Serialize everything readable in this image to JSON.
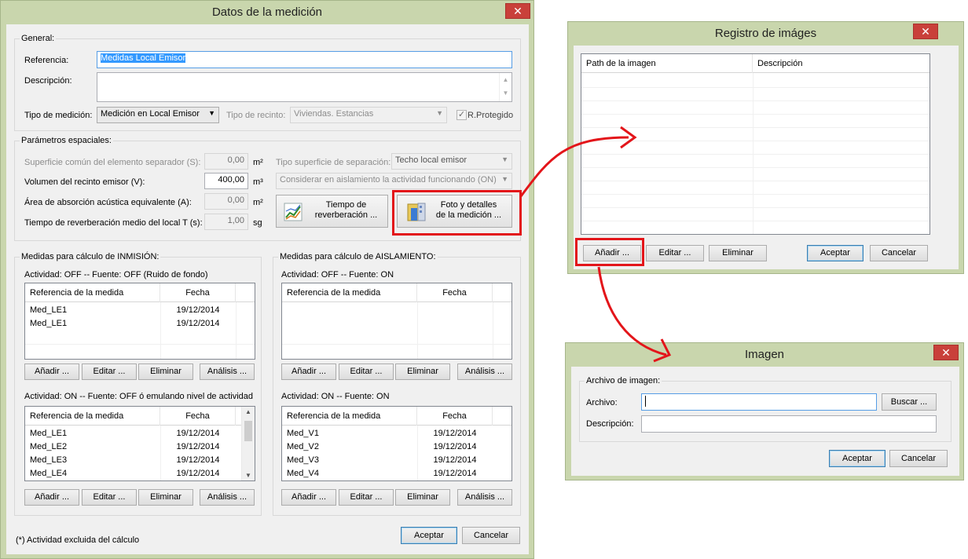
{
  "datos": {
    "title": "Datos de la medición",
    "close": "✕",
    "general": {
      "label": "General:",
      "referencia_label": "Referencia:",
      "referencia_value": "Medidas Local Emisor",
      "descripcion_label": "Descripción:",
      "tipo_medicion_label": "Tipo de medición:",
      "tipo_medicion_value": "Medición en Local Emisor",
      "tipo_recinto_label": "Tipo de recinto:",
      "tipo_recinto_value": "Viviendas. Estancias",
      "r_protegido": "R.Protegido"
    },
    "param": {
      "label": "Parámetros espaciales:",
      "superficie_label": "Superficie común del elemento separador (S):",
      "superficie_value": "0,00",
      "superficie_unit": "m²",
      "volumen_label": "Volumen del recinto emisor (V):",
      "volumen_value": "400,00",
      "volumen_unit": "m³",
      "area_label": "Área de absorción acústica equivalente (A):",
      "area_value": "0,00",
      "area_unit": "m²",
      "tiempo_label": "Tiempo de reverberación medio del local T (s):",
      "tiempo_value": "1,00",
      "tiempo_unit": "sg",
      "tipo_sup_label": "Tipo superficie de separación:",
      "tipo_sup_value": "Techo local emisor",
      "considerar_value": "Considerar en aislamiento la actividad funcionando (ON)",
      "btn_tiempo_line1": "Tiempo de",
      "btn_tiempo_line2": "reverberación ...",
      "btn_foto_line1": "Foto y detalles",
      "btn_foto_line2": "de la medición ..."
    },
    "inmision": {
      "label": "Medidas para cálculo de INMISIÓN:",
      "act1": "Actividad: OFF -- Fuente: OFF  (Ruido de fondo)",
      "col_ref": "Referencia de la medida",
      "col_fecha": "Fecha",
      "rows1": [
        {
          "ref": "Med_LE1",
          "fecha": "19/12/2014"
        },
        {
          "ref": "Med_LE1",
          "fecha": "19/12/2014"
        }
      ],
      "act2": "Actividad: ON -- Fuente: OFF ó emulando nivel de actividad",
      "rows2": [
        {
          "ref": "Med_LE1",
          "fecha": "19/12/2014"
        },
        {
          "ref": "Med_LE2",
          "fecha": "19/12/2014"
        },
        {
          "ref": "Med_LE3",
          "fecha": "19/12/2014"
        },
        {
          "ref": "Med_LE4",
          "fecha": "19/12/2014"
        }
      ]
    },
    "aislamiento": {
      "label": "Medidas para cálculo de AISLAMIENTO:",
      "act1": "Actividad: OFF -- Fuente: ON",
      "col_ref": "Referencia de la medida",
      "col_fecha": "Fecha",
      "act2": "Actividad: ON -- Fuente: ON",
      "rows2": [
        {
          "ref": "Med_V1",
          "fecha": "19/12/2014"
        },
        {
          "ref": "Med_V2",
          "fecha": "19/12/2014"
        },
        {
          "ref": "Med_V3",
          "fecha": "19/12/2014"
        },
        {
          "ref": "Med_V4",
          "fecha": "19/12/2014"
        }
      ]
    },
    "buttons": {
      "anadir": "Añadir ...",
      "editar": "Editar ...",
      "eliminar": "Eliminar",
      "analisis": "Análisis ..."
    },
    "footnote": "(*) Actividad excluida del cálculo",
    "aceptar": "Aceptar",
    "cancelar": "Cancelar"
  },
  "registro": {
    "title": "Registro de imáges",
    "close": "✕",
    "col_path": "Path de la imagen",
    "col_desc": "Descripción",
    "anadir": "Añadir ...",
    "editar": "Editar ...",
    "eliminar": "Eliminar",
    "aceptar": "Aceptar",
    "cancelar": "Cancelar"
  },
  "imagen": {
    "title": "Imagen",
    "close": "✕",
    "group_label": "Archivo de imagen:",
    "archivo_label": "Archivo:",
    "descripcion_label": "Descripción:",
    "buscar": "Buscar ...",
    "aceptar": "Aceptar",
    "cancelar": "Cancelar"
  },
  "colors": {
    "frame": "#c9d6ad",
    "highlight": "#e3151a",
    "close": "#c9403a"
  }
}
